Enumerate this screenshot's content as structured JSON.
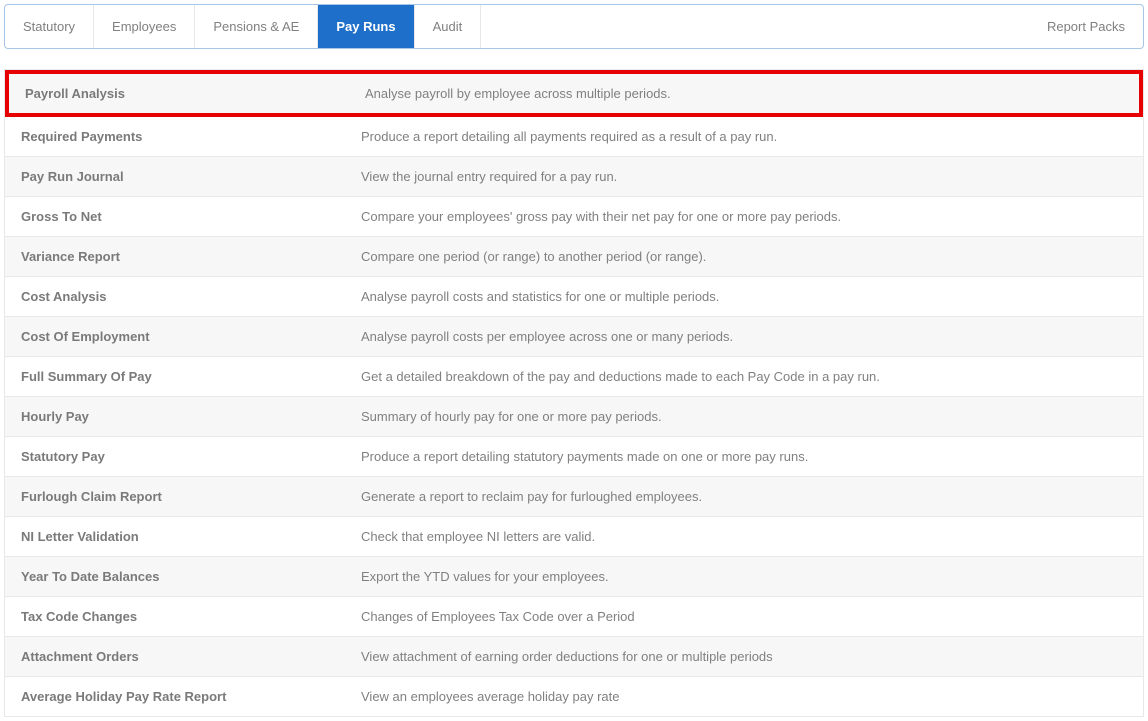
{
  "tabs": {
    "items": [
      {
        "label": "Statutory",
        "active": false
      },
      {
        "label": "Employees",
        "active": false
      },
      {
        "label": "Pensions & AE",
        "active": false
      },
      {
        "label": "Pay Runs",
        "active": true
      },
      {
        "label": "Audit",
        "active": false
      }
    ],
    "right_label": "Report Packs"
  },
  "reports": [
    {
      "title": "Payroll Analysis",
      "desc": "Analyse payroll by employee across multiple periods.",
      "highlighted": true
    },
    {
      "title": "Required Payments",
      "desc": "Produce a report detailing all payments required as a result of a pay run.",
      "highlighted": false
    },
    {
      "title": "Pay Run Journal",
      "desc": "View the journal entry required for a pay run.",
      "highlighted": false
    },
    {
      "title": "Gross To Net",
      "desc": "Compare your employees' gross pay with their net pay for one or more pay periods.",
      "highlighted": false
    },
    {
      "title": "Variance Report",
      "desc": "Compare one period (or range) to another period (or range).",
      "highlighted": false
    },
    {
      "title": "Cost Analysis",
      "desc": "Analyse payroll costs and statistics for one or multiple periods.",
      "highlighted": false
    },
    {
      "title": "Cost Of Employment",
      "desc": "Analyse payroll costs per employee across one or many periods.",
      "highlighted": false
    },
    {
      "title": "Full Summary Of Pay",
      "desc": "Get a detailed breakdown of the pay and deductions made to each Pay Code in a pay run.",
      "highlighted": false
    },
    {
      "title": "Hourly Pay",
      "desc": "Summary of hourly pay for one or more pay periods.",
      "highlighted": false
    },
    {
      "title": "Statutory Pay",
      "desc": "Produce a report detailing statutory payments made on one or more pay runs.",
      "highlighted": false
    },
    {
      "title": "Furlough Claim Report",
      "desc": "Generate a report to reclaim pay for furloughed employees.",
      "highlighted": false
    },
    {
      "title": "NI Letter Validation",
      "desc": "Check that employee NI letters are valid.",
      "highlighted": false
    },
    {
      "title": "Year To Date Balances",
      "desc": "Export the YTD values for your employees.",
      "highlighted": false
    },
    {
      "title": "Tax Code Changes",
      "desc": "Changes of Employees Tax Code over a Period",
      "highlighted": false
    },
    {
      "title": "Attachment Orders",
      "desc": "View attachment of earning order deductions for one or multiple periods",
      "highlighted": false
    },
    {
      "title": "Average Holiday Pay Rate Report",
      "desc": "View an employees average holiday pay rate",
      "highlighted": false
    }
  ]
}
